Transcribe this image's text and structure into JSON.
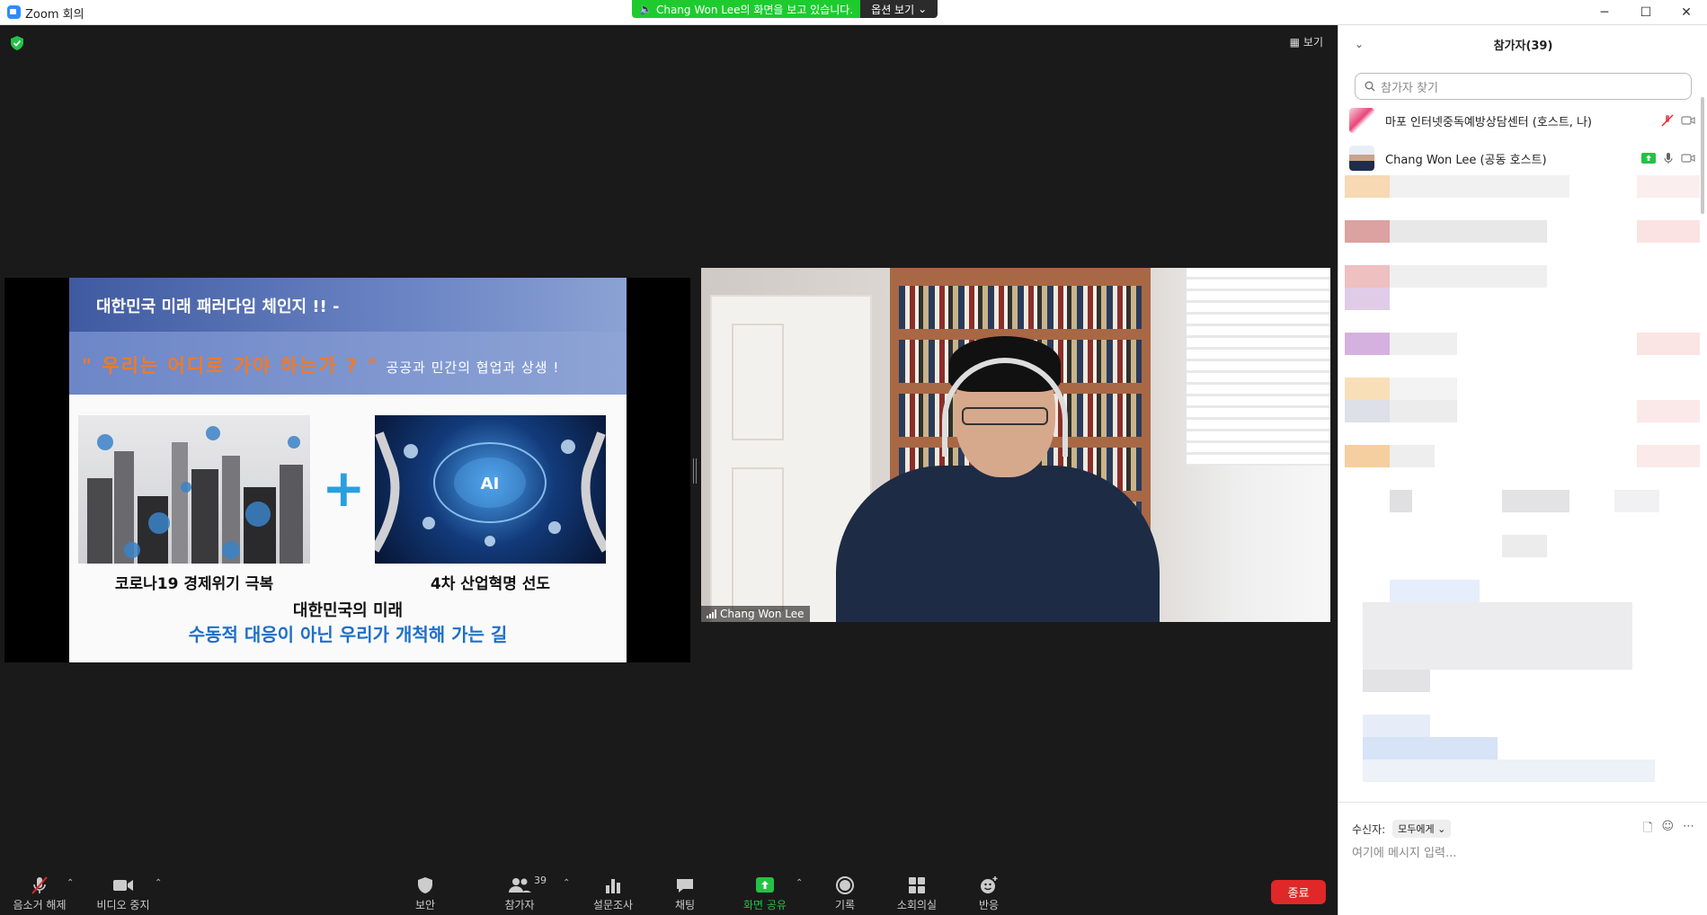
{
  "window": {
    "title": "Zoom 회의",
    "minimize": "─",
    "maximize": "☐",
    "close": "✕"
  },
  "banner": {
    "message": "Chang Won Lee의 화면을 보고 있습니다.",
    "options": "옵션 보기"
  },
  "stage": {
    "view_label": "보기"
  },
  "slide": {
    "heading": "대한민국 미래 패러다임 체인지 !! -",
    "question": "\" 우리는 어디로 가야 하는가 ? \"",
    "subtitle": "공공과 민간의 협업과 상생 !",
    "plus": "+",
    "ai_text": "AI",
    "caption_left": "코로나19 경제위기 극복",
    "caption_right": "4차 산업혁명 선도",
    "future_line1": "대한민국의 미래",
    "future_line2": "수동적 대응이 아닌 우리가 개척해 가는 길"
  },
  "video": {
    "name": "Chang Won Lee"
  },
  "toolbar": {
    "unmute": "음소거 해제",
    "stop_video": "비디오 중지",
    "security": "보안",
    "participants": "참가자",
    "participants_count": "39",
    "polls": "설문조사",
    "chat": "채팅",
    "share_screen": "화면 공유",
    "record": "기록",
    "breakout": "소회의실",
    "reactions": "반응",
    "end": "종료"
  },
  "panel": {
    "title": "참가자(39)",
    "search_placeholder": "참가자 찾기",
    "participants": [
      {
        "name": "마포 인터넷중독예방상담센터 (호스트, 나)"
      },
      {
        "name": "Chang Won Lee (공동 호스트)"
      }
    ],
    "recipient_label": "수신자:",
    "recipient_value": "모두에게",
    "chat_placeholder": "여기에 메시지 입력..."
  },
  "colors": {
    "accent": "#2d8cff",
    "share_green": "#1ecb2e",
    "end_red": "#e02828",
    "slide_orange": "#f07a28",
    "slide_blue": "#1e6fc8"
  }
}
